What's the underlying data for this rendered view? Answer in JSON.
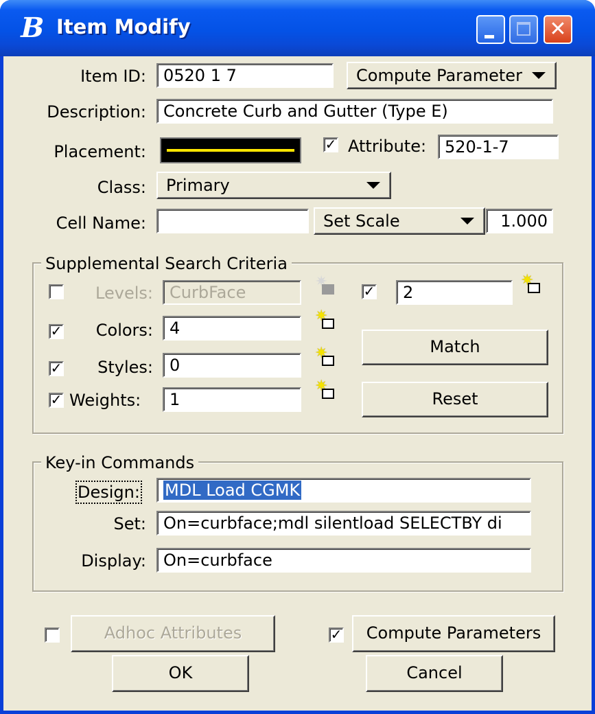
{
  "window": {
    "title": "Item Modify",
    "controls": {
      "minimize": "_",
      "maximize": "□",
      "close": "✕"
    }
  },
  "item": {
    "id_label": "Item ID:",
    "id_value": "0520  1  7",
    "compute_menu_label": "Compute Parameter",
    "description_label": "Description:",
    "description_value": "Concrete Curb and Gutter (Type E)",
    "placement_label": "Placement:",
    "attribute_checked": true,
    "attribute_label": "Attribute:",
    "attribute_value": "520-1-7",
    "class_label": "Class:",
    "class_value": "Primary",
    "cell_name_label": "Cell Name:",
    "cell_name_value": "",
    "scale_menu_label": "Set Scale",
    "scale_value": "1.000"
  },
  "supplemental": {
    "title": "Supplemental Search Criteria",
    "levels": {
      "checked": false,
      "label": "Levels:",
      "value": "CurbFace",
      "enabled": false
    },
    "level_extra": {
      "checked": true,
      "value": "2"
    },
    "colors": {
      "checked": true,
      "label": "Colors:",
      "value": "4"
    },
    "styles": {
      "checked": true,
      "label": "Styles:",
      "value": "0"
    },
    "weights": {
      "checked": true,
      "label": "Weights:",
      "value": "1"
    },
    "match_label": "Match",
    "reset_label": "Reset"
  },
  "keyin": {
    "title": "Key-in Commands",
    "design_label": "Design:",
    "design_value": "MDL Load CGMK",
    "set_label": "Set:",
    "set_value": "On=curbface;mdl silentload SELECTBY di",
    "display_label": "Display:",
    "display_value": "On=curbface"
  },
  "footer": {
    "adhoc_checked": false,
    "adhoc_label": "Adhoc Attributes",
    "compute_checked": true,
    "compute_label": "Compute Parameters",
    "ok_label": "OK",
    "cancel_label": "Cancel"
  },
  "glyphs": {
    "check": "✓",
    "star": "✷"
  },
  "colors": {
    "titlebar": "#0452e6",
    "dialog_bg": "#ece9d8",
    "placement_line": "#ffe500",
    "selection": "#316ac5"
  }
}
